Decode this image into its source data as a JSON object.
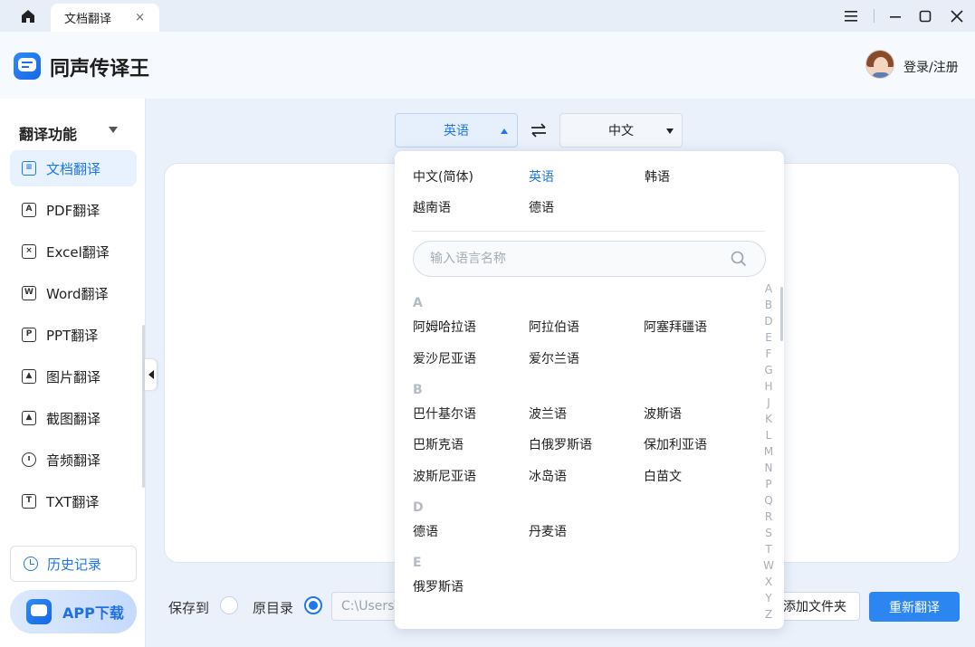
{
  "titlebar": {
    "tab_label": "文档翻译",
    "tab_close": "×"
  },
  "header": {
    "app_name": "同声传译王",
    "login_label": "登录/注册"
  },
  "sidebar": {
    "section_title": "翻译功能",
    "items": [
      {
        "label": "文档翻译",
        "icon": "document-icon",
        "active": true
      },
      {
        "label": "PDF翻译",
        "icon": "pdf-icon",
        "active": false
      },
      {
        "label": "Excel翻译",
        "icon": "excel-icon",
        "active": false
      },
      {
        "label": "Word翻译",
        "icon": "word-icon",
        "active": false
      },
      {
        "label": "PPT翻译",
        "icon": "ppt-icon",
        "active": false
      },
      {
        "label": "图片翻译",
        "icon": "image-icon",
        "active": false
      },
      {
        "label": "截图翻译",
        "icon": "screenshot-icon",
        "active": false
      },
      {
        "label": "音频翻译",
        "icon": "audio-icon",
        "active": false
      },
      {
        "label": "TXT翻译",
        "icon": "txt-icon",
        "active": false
      }
    ],
    "history_label": "历史记录",
    "app_download_label": "APP下载"
  },
  "language_bar": {
    "source": "英语",
    "target": "中文"
  },
  "language_dropdown": {
    "common": [
      "中文(简体)",
      "英语",
      "韩语",
      "越南语",
      "德语"
    ],
    "selected": "英语",
    "search_placeholder": "输入语言名称",
    "groups": [
      {
        "letter": "A",
        "languages": [
          "阿姆哈拉语",
          "阿拉伯语",
          "阿塞拜疆语",
          "爱沙尼亚语",
          "爱尔兰语"
        ]
      },
      {
        "letter": "B",
        "languages": [
          "巴什基尔语",
          "波兰语",
          "波斯语",
          "巴斯克语",
          "白俄罗斯语",
          "保加利亚语",
          "波斯尼亚语",
          "冰岛语",
          "白苗文"
        ]
      },
      {
        "letter": "D",
        "languages": [
          "德语",
          "丹麦语"
        ]
      },
      {
        "letter": "E",
        "languages": [
          "俄罗斯语"
        ]
      }
    ],
    "alphabet": [
      "A",
      "B",
      "D",
      "E",
      "F",
      "G",
      "H",
      "J",
      "K",
      "L",
      "M",
      "N",
      "P",
      "Q",
      "R",
      "S",
      "T",
      "W",
      "X",
      "Y",
      "Z"
    ]
  },
  "footer": {
    "save_to_label": "保存到",
    "original_dir_label": "原目录",
    "path_value": "C:\\Users\\",
    "add_folder_label": "添加文件夹",
    "retranslate_label": "重新翻译"
  },
  "colors": {
    "accent": "#1f77ee",
    "primary_button": "#2b86f1",
    "background": "#eaf1fb"
  }
}
